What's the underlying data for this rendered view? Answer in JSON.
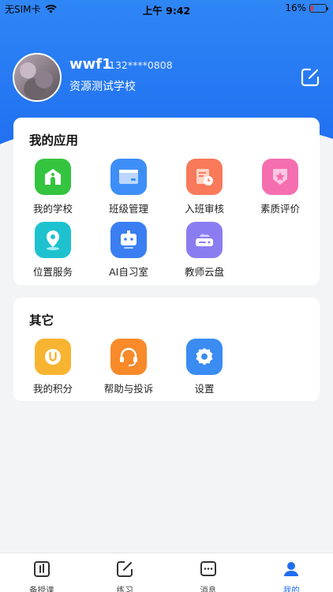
{
  "status_bar": {
    "carrier": "无SIM卡",
    "time": "上午 9:42",
    "battery": "16%",
    "battery_level": 0.16
  },
  "profile": {
    "username": "wwf1",
    "phone": "132****0808",
    "school": "资源测试学校"
  },
  "apps_section": {
    "title": "我的应用",
    "items": [
      {
        "label": "我的学校",
        "icon": "school-icon",
        "color": "#35c43f"
      },
      {
        "label": "班级管理",
        "icon": "class-board-icon",
        "color": "#3d8ef7"
      },
      {
        "label": "入班审核",
        "icon": "review-clock-icon",
        "color": "#f87a5a"
      },
      {
        "label": "素质评价",
        "icon": "badge-star-icon",
        "color": "#f56fb0"
      },
      {
        "label": "位置服务",
        "icon": "location-pin-icon",
        "color": "#1ec2cf"
      },
      {
        "label": "AI自习室",
        "icon": "robot-icon",
        "color": "#3a7ef2"
      },
      {
        "label": "教师云盘",
        "icon": "cloud-drive-icon",
        "color": "#8a7df2"
      }
    ]
  },
  "other_section": {
    "title": "其它",
    "items": [
      {
        "label": "我的积分",
        "icon": "points-icon",
        "color": "#f7b431"
      },
      {
        "label": "帮助与投诉",
        "icon": "headset-icon",
        "color": "#f88a2a"
      },
      {
        "label": "设置",
        "icon": "gear-icon",
        "color": "#3a8cf2"
      }
    ]
  },
  "bottom_nav": {
    "items": [
      {
        "label": "备授课",
        "icon": "lesson-icon"
      },
      {
        "label": "练习",
        "icon": "practice-icon"
      },
      {
        "label": "消息",
        "icon": "message-icon"
      },
      {
        "label": "我的",
        "icon": "profile-icon",
        "active": true
      }
    ]
  },
  "colors": {
    "accent": "#1f6ef0",
    "header_blue": "#2f86f5",
    "background": "#f3f4f6"
  }
}
